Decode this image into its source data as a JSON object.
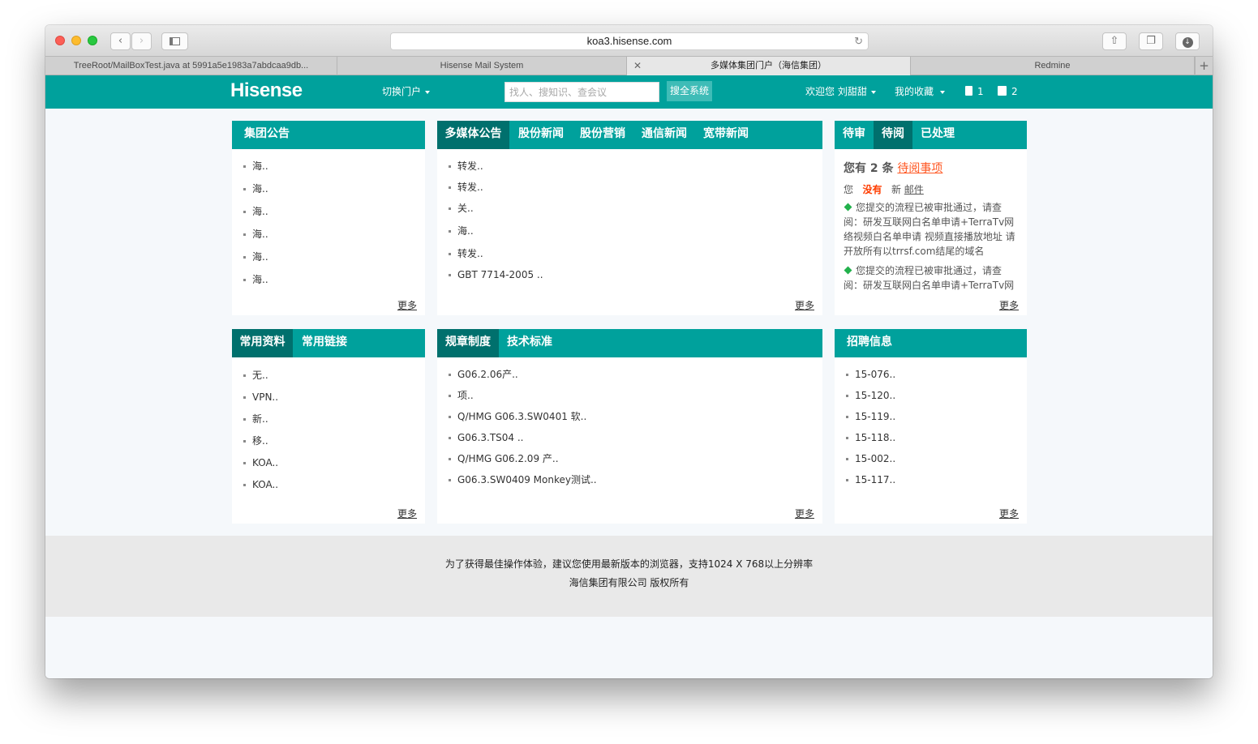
{
  "browser": {
    "url": "koa3.hisense.com",
    "tabs": [
      {
        "label": "TreeRoot/MailBoxTest.java at 5991a5e1983a7abdcaa9db..."
      },
      {
        "label": "Hisense Mail System"
      },
      {
        "label": "多媒体集团门户（海信集团）"
      },
      {
        "label": "Redmine"
      }
    ]
  },
  "header": {
    "logo": "Hisense",
    "switch_portal": "切换门户",
    "search_placeholder": "找人、搜知识、查会议",
    "search_button": "搜全系统",
    "welcome": "欢迎您 刘甜甜",
    "favorites": "我的收藏",
    "count1": "1",
    "count2": "2"
  },
  "panels": {
    "group_notice": {
      "title": "集团公告",
      "items": [
        "海..",
        "海..",
        "海..",
        "海..",
        "海..",
        "海.."
      ],
      "more": "更多"
    },
    "media": {
      "tabs": [
        "多媒体公告",
        "股份新闻",
        "股份营销",
        "通信新闻",
        "宽带新闻"
      ],
      "items": [
        "转发..",
        "转发..",
        "关..",
        "海..",
        "转发..",
        "GBT 7714-2005 .."
      ],
      "more": "更多"
    },
    "tasks": {
      "tabs": [
        "待审",
        "待阅",
        "已处理"
      ],
      "pending_prefix": "您有",
      "pending_count": "2",
      "pending_unit": "条",
      "pending_link": "待阅事项",
      "mail_you": "您",
      "mail_none": "没有",
      "mail_new": "新",
      "mail_link": "邮件",
      "notices": [
        "您提交的流程已被审批通过，请查阅：研发互联网白名单申请+TerraTv网络视频白名单申请 视频直接播放地址 请开放所有以trrsf.com结尾的域名",
        "您提交的流程已被审批通过，请查阅：研发互联网白名单申请+TerraTv网络视频白名单申请 视频直接播放地址"
      ],
      "more": "更多"
    },
    "resources": {
      "tabs": [
        "常用资料",
        "常用链接"
      ],
      "items": [
        "无..",
        "VPN..",
        "新..",
        "移..",
        "KOA..",
        "KOA.."
      ],
      "more": "更多"
    },
    "rules": {
      "tabs": [
        "规章制度",
        "技术标准"
      ],
      "items": [
        "G06.2.06产..",
        "项..",
        "Q/HMG G06.3.SW0401 软..",
        "G06.3.TS04 ..",
        "Q/HMG G06.2.09 产..",
        "G06.3.SW0409 Monkey测试.."
      ],
      "more": "更多"
    },
    "jobs": {
      "title": "招聘信息",
      "items": [
        "15-076..",
        "15-120..",
        "15-119..",
        "15-118..",
        "15-002..",
        "15-117.."
      ],
      "more": "更多"
    }
  },
  "footer": {
    "line1": "为了获得最佳操作体验，建议您使用最新版本的浏览器，支持1024 X 768以上分辨率",
    "line2": "海信集团有限公司 版权所有"
  },
  "colors": {
    "brand": "#00a19c",
    "brand_dark": "#00706d",
    "alert": "#ff5722"
  }
}
